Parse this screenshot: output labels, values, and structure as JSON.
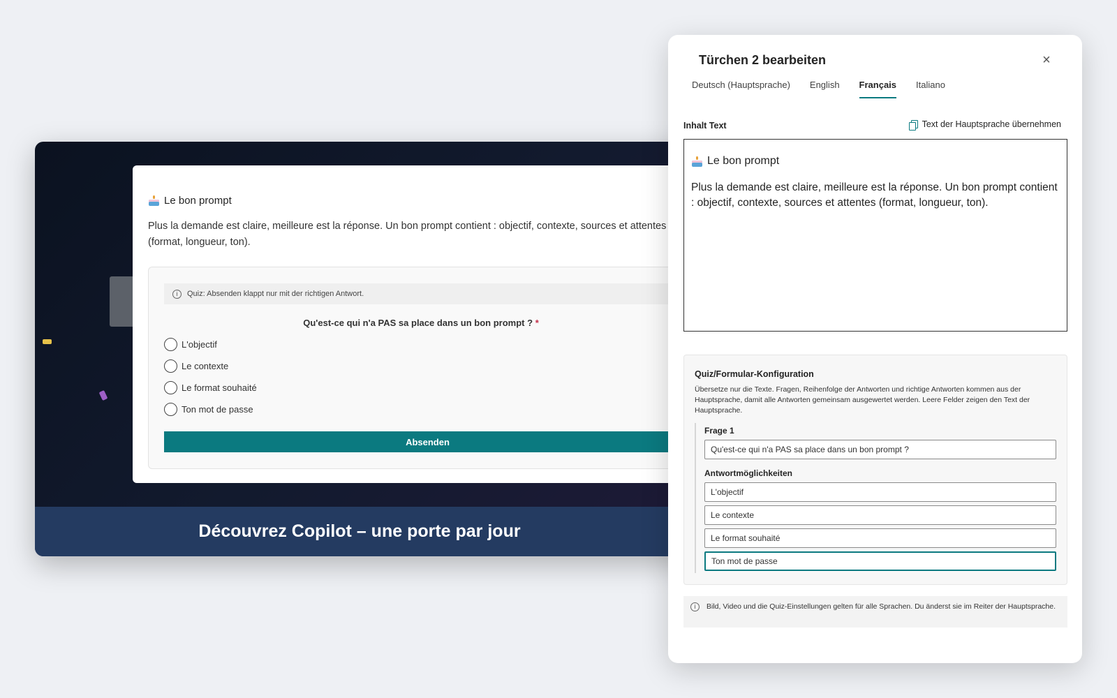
{
  "preview": {
    "card_title": "Le bon prompt",
    "card_body": "Plus la demande est claire, meilleure est la réponse. Un bon prompt contient : objectif, contexte, sources et attentes (format, longueur, ton).",
    "quiz_info": "Quiz: Absenden klappt nur mit der richtigen Antwort.",
    "question": "Qu'est-ce qui n'a PAS sa place dans un bon prompt ?",
    "required_mark": "*",
    "options": [
      "L'objectif",
      "Le contexte",
      "Le format souhaité",
      "Ton mot de passe"
    ],
    "submit_label": "Absenden",
    "banner": "Découvrez Copilot – une porte par jour"
  },
  "panel": {
    "title": "Türchen 2 bearbeiten",
    "close_symbol": "×",
    "tabs": [
      {
        "label": "Deutsch (Hauptsprache)"
      },
      {
        "label": "English"
      },
      {
        "label": "Français"
      },
      {
        "label": "Italiano"
      }
    ],
    "active_tab": "Français",
    "content_label": "Inhalt Text",
    "copy_link": "Text der Hauptsprache übernehmen",
    "editor_title": "Le bon prompt",
    "editor_body": "Plus la demande est claire, meilleure est la réponse. Un bon prompt contient : objectif, contexte, sources et attentes (format, longueur, ton).",
    "config": {
      "title": "Quiz/Formular-Konfiguration",
      "description": "Übersetze nur die Texte. Fragen, Reihenfolge der Antworten und richtige Antworten kommen aus der Hauptsprache, damit alle Antworten gemeinsam ausgewertet werden. Leere Felder zeigen den Text der Hauptsprache.",
      "question_label": "Frage 1",
      "question_value": "Qu'est-ce qui n'a PAS sa place dans un bon prompt ?",
      "answers_label": "Antwortmöglichkeiten",
      "answers": [
        "L'objectif",
        "Le contexte",
        "Le format souhaité",
        "Ton mot de passe"
      ]
    },
    "note": "Bild, Video und die Quiz-Einstellungen gelten für alle Sprachen. Du änderst sie im Reiter der Hauptsprache."
  },
  "colors": {
    "accent": "#0b7a80",
    "banner": "#243b61",
    "required": "#c4314b"
  }
}
